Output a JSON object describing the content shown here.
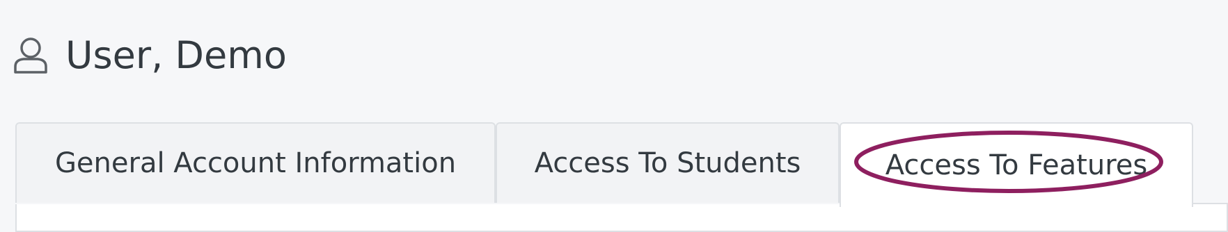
{
  "header": {
    "icon": "user-icon",
    "title": "User, Demo"
  },
  "tabs": [
    {
      "label": "General Account Information",
      "active": false
    },
    {
      "label": "Access To Students",
      "active": false
    },
    {
      "label": "Access To Features",
      "active": true,
      "highlighted": true
    }
  ],
  "colors": {
    "background": "#f6f7f9",
    "tab_inactive": "#f2f3f5",
    "tab_active": "#ffffff",
    "border": "#dde0e4",
    "text": "#333a40",
    "highlight": "#8e1f5f"
  }
}
